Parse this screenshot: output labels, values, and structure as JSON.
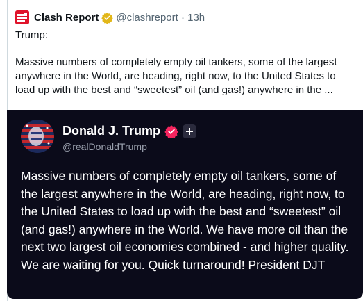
{
  "tweet": {
    "author_name": "Clash Report",
    "handle_time": "@clashreport · 13h",
    "label": "Trump:",
    "text": "Massive numbers of completely empty oil tankers, some of the largest anywhere in the World, are heading, right now, to the United States to load up with the best and “sweetest” oil (and gas!) anywhere in the ..."
  },
  "quoted": {
    "name": "Donald J. Trump",
    "handle": "@realDonaldTrump",
    "text": "Massive numbers of completely empty oil tankers, some of the largest anywhere in the World, are heading, right now, to the United States to load up with the best and “sweetest” oil (and gas!) anywhere in the World. We have more oil than the next two largest oil economies combined - and higher quality. We are waiting for you. Quick turnaround! President DJT"
  },
  "colors": {
    "brand_red": "#e0142b",
    "verified_gold": "#e2b719",
    "verified_red": "#f4245e",
    "quote_background": "#0b0b1a",
    "text_primary": "#0f1419",
    "text_secondary": "#536471"
  },
  "icons": {
    "author_logo": "clash-report-logo",
    "author_badge": "verified-gold-badge",
    "quoted_badge": "verified-red-badge",
    "quoted_extra": "plus-icon"
  }
}
